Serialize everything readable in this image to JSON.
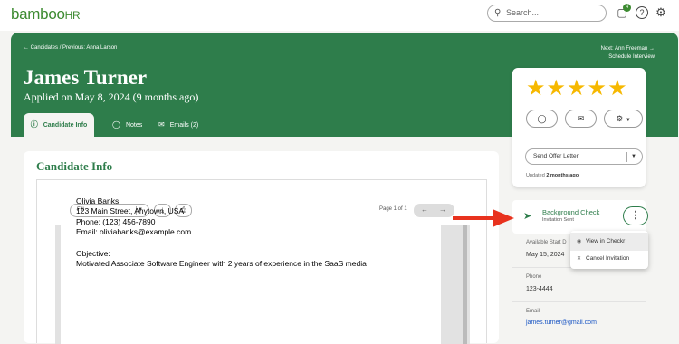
{
  "topbar": {
    "logo": "bamboo",
    "logo_suffix": "HR",
    "search_placeholder": "Search...",
    "notification_count": "4"
  },
  "header": {
    "breadcrumb": "← Candidates / Previous: Anna Larson",
    "next_label": "Next: Ann Freeman →",
    "next_sub": "Schedule Interview",
    "candidate_name": "James Turner",
    "applied_text": "Applied on May 8, 2024 (9 months ago)",
    "tabs": [
      {
        "label": "Candidate Info",
        "icon": "info-icon"
      },
      {
        "label": "Notes",
        "icon": "chat-icon"
      },
      {
        "label": "Emails (2)",
        "icon": "mail-icon"
      }
    ]
  },
  "candidate_info": {
    "title": "Candidate Info",
    "viewer": {
      "fill_label": "Fill",
      "page_info": "Page 1 of 1"
    },
    "resume_lines": [
      "Olivia Banks",
      "123 Main Street, Anytown, USA",
      "Phone: (123) 456-7890",
      "Email: oliviabanks@example.com",
      "Objective:",
      "Motivated Associate Software Engineer with 2 years of experience in the SaaS media"
    ]
  },
  "rating": {
    "stars": 5,
    "star_color": "#f6b800",
    "offer_select": "Send Offer Letter",
    "updated_prefix": "Updated",
    "updated_value": "2 months ago"
  },
  "background_check": {
    "title": "Background Check",
    "status": "Invitation Sent"
  },
  "fields": {
    "start_label": "Available Start D",
    "start_value": "May 15, 2024",
    "phone_label": "Phone",
    "phone_value": "123-4444",
    "email_label": "Email",
    "email_value": "james.turner@gmail.com"
  },
  "menu": {
    "items": [
      {
        "label": "View in Checkr",
        "icon": "eye-icon"
      },
      {
        "label": "Cancel Invitation",
        "icon": "x-icon"
      }
    ]
  },
  "colors": {
    "brand_green": "#2e7d4b",
    "arrow_red": "#e8321e",
    "link_blue": "#1a56c4"
  }
}
